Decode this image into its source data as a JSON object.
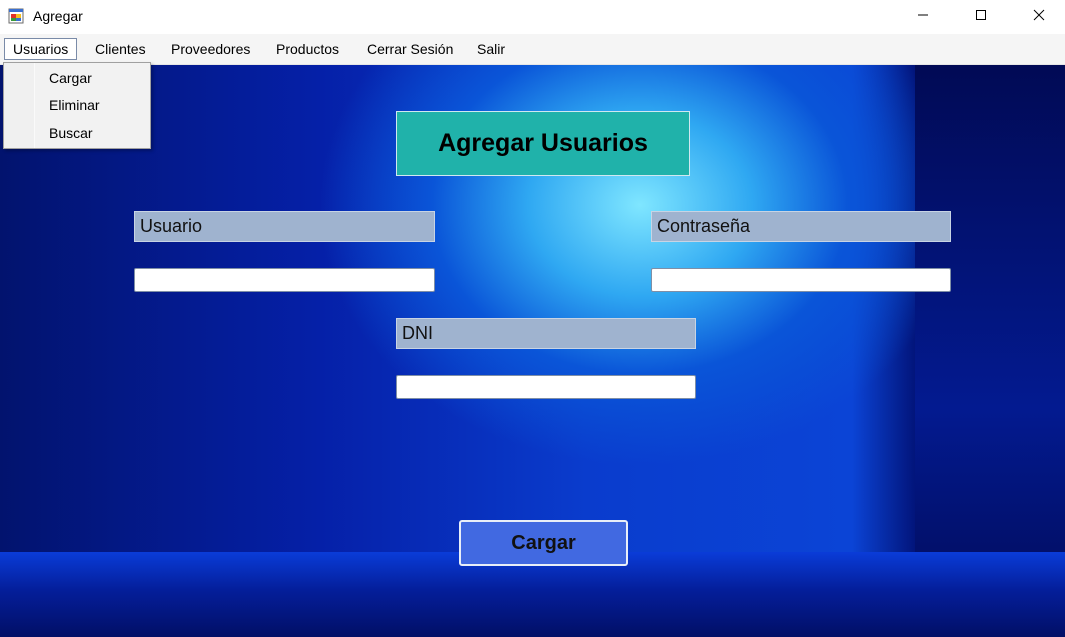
{
  "window": {
    "title": "Agregar",
    "icon": "windows-form-icon",
    "controls": [
      "minimize-icon",
      "maximize-icon",
      "close-icon"
    ]
  },
  "menu": {
    "items": [
      {
        "label": "Usuarios",
        "active": true
      },
      {
        "label": "Clientes"
      },
      {
        "label": "Proveedores"
      },
      {
        "label": "Productos"
      },
      {
        "label": "Cerrar Sesión"
      },
      {
        "label": "Salir"
      }
    ],
    "dropdown": {
      "items": [
        {
          "label": "Cargar"
        },
        {
          "label": "Eliminar"
        },
        {
          "label": "Buscar"
        }
      ]
    }
  },
  "form": {
    "heading": "Agregar Usuarios",
    "fields": {
      "usuario": {
        "label": "Usuario",
        "value": ""
      },
      "contrasena": {
        "label": "Contraseña",
        "value": ""
      },
      "dni": {
        "label": "DNI",
        "value": ""
      }
    },
    "submit_label": "Cargar"
  },
  "colors": {
    "heading_bg": "#20b2aa",
    "label_bg": "#9fb3cf",
    "button_bg": "#4169e1",
    "background": "#0a3ccd"
  }
}
